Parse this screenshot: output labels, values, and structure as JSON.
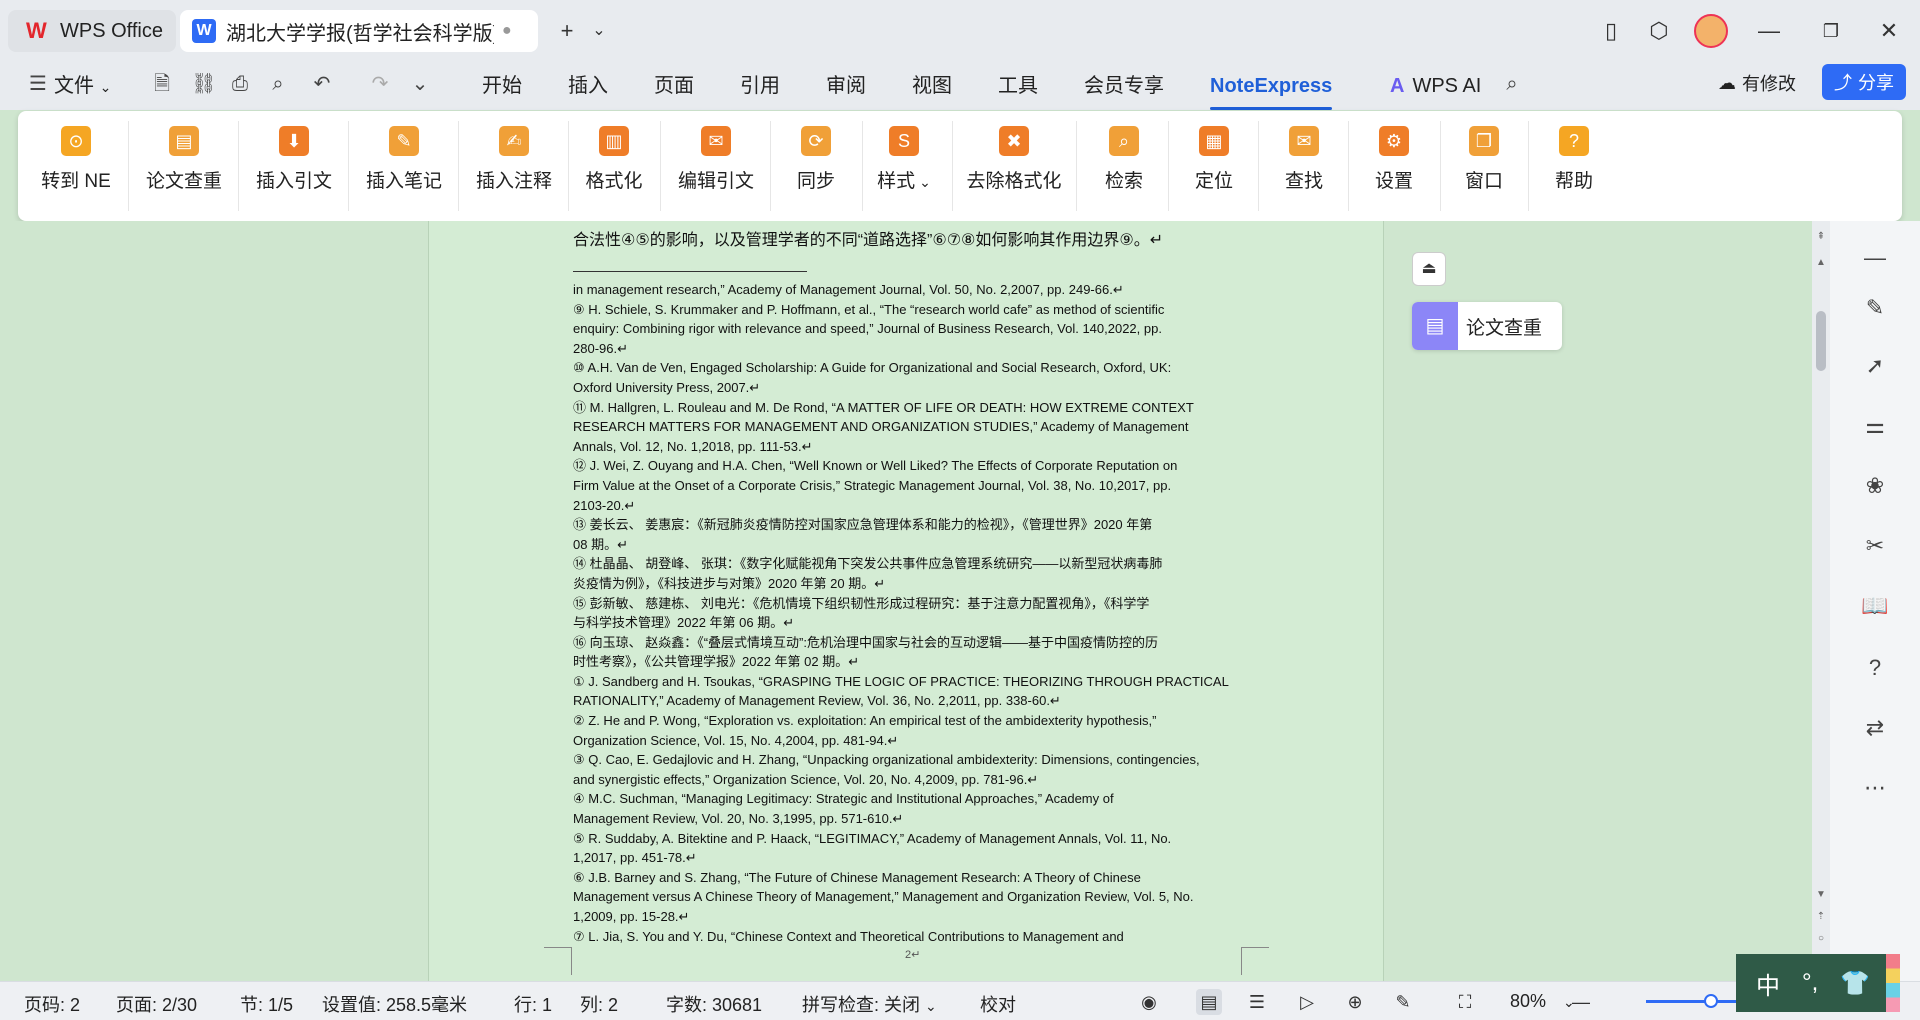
{
  "tabs": [
    {
      "label": "WPS Office"
    },
    {
      "label": "湖北大学学报(哲学社会科学版) 投稿",
      "modified": "●"
    }
  ],
  "titlebar": {
    "new_tab": "+",
    "dropdown": "⌄"
  },
  "menu": {
    "file": "文件",
    "items": [
      "开始",
      "插入",
      "页面",
      "引用",
      "审阅",
      "视图",
      "工具",
      "会员专享",
      "NoteExpress",
      "WPS AI"
    ],
    "active": "NoteExpress",
    "modify": "有修改",
    "share": "分享"
  },
  "ribbon": [
    {
      "label": "转到 NE",
      "color": "#f5a623",
      "icon": "ne-icon"
    },
    {
      "label": "论文查重",
      "color": "#f0a038",
      "icon": "clipboard-icon"
    },
    {
      "label": "插入引文",
      "color": "#ef7d28",
      "icon": "insert-citation-icon"
    },
    {
      "label": "插入笔记",
      "color": "#f0a038",
      "icon": "pencil-icon"
    },
    {
      "label": "插入注释",
      "color": "#f0a038",
      "icon": "annotation-icon"
    },
    {
      "label": "格式化",
      "color": "#ef7d28",
      "icon": "format-icon"
    },
    {
      "label": "编辑引文",
      "color": "#ef7d28",
      "icon": "edit-citation-icon"
    },
    {
      "label": "同步",
      "color": "#f0a038",
      "icon": "sync-icon"
    },
    {
      "label": "样式",
      "color": "#ef7d28",
      "icon": "style-icon"
    },
    {
      "label": "去除格式化",
      "color": "#ef7d28",
      "icon": "remove-format-icon"
    },
    {
      "label": "检索",
      "color": "#f0a038",
      "icon": "search-icon"
    },
    {
      "label": "定位",
      "color": "#ef7d28",
      "icon": "locate-icon"
    },
    {
      "label": "查找",
      "color": "#f0a038",
      "icon": "find-icon"
    },
    {
      "label": "设置",
      "color": "#ef7d28",
      "icon": "gear-icon"
    },
    {
      "label": "窗口",
      "color": "#f0a038",
      "icon": "window-icon"
    },
    {
      "label": "帮助",
      "color": "#f5a623",
      "icon": "help-icon"
    }
  ],
  "document": {
    "head_line": "合法性④⑤的影响，以及管理学者的不同“道路选择”⑥⑦⑧如何影响其作用边界⑨。↵",
    "ref_lines": [
      "in management research,” Academy of Management Journal, Vol. 50, No. 2,2007, pp. 249-66.↵",
      "⑨ H. Schiele, S. Krummaker and P. Hoffmann, et al., “The “research world cafe” as method of scientific",
      "enquiry: Combining rigor with relevance and speed,” Journal of Business Research, Vol. 140,2022, pp.",
      "280-96.↵",
      "⑩ A.H. Van de Ven, Engaged Scholarship: A Guide for Organizational and Social Research, Oxford, UK:",
      "Oxford University Press, 2007.↵",
      "⑪ M. Hallgren, L. Rouleau and M. De Rond, “A MATTER OF LIFE OR DEATH: HOW EXTREME CONTEXT",
      "RESEARCH MATTERS FOR MANAGEMENT AND ORGANIZATION STUDIES,” Academy of Management",
      "Annals, Vol. 12, No. 1,2018, pp. 111-53.↵",
      "⑫ J. Wei, Z. Ouyang and H.A. Chen, “Well Known or Well Liked? The Effects of Corporate Reputation on",
      "Firm Value at the Onset of a Corporate Crisis,” Strategic Management Journal, Vol. 38, No. 10,2017, pp.",
      "2103-20.↵",
      "⑬ 姜长云、 姜惠宸：《新冠肺炎疫情防控对国家应急管理体系和能力的检视》，《管理世界》2020 年第",
      "08 期。↵",
      "⑭ 杜晶晶、 胡登峰、 张琪：《数字化赋能视角下突发公共事件应急管理系统研究——以新型冠状病毒肺",
      "炎疫情为例》，《科技进步与对策》2020 年第 20 期。↵",
      "⑮ 彭新敏、 慈建栋、 刘电光：《危机情境下组织韧性形成过程研究：基于注意力配置视角》，《科学学",
      "与科学技术管理》2022 年第 06 期。↵",
      "⑯ 向玉琼、 赵焱鑫：《“叠层式情境互动”:危机治理中国家与社会的互动逻辑——基于中国疫情防控的历",
      "时性考察》，《公共管理学报》2022 年第 02 期。↵",
      "① J. Sandberg and H. Tsoukas, “GRASPING THE LOGIC OF PRACTICE: THEORIZING THROUGH PRACTICAL",
      "RATIONALITY,” Academy of Management Review, Vol. 36, No. 2,2011, pp. 338-60.↵",
      "② Z. He and P. Wong, “Exploration vs. exploitation: An empirical test of the ambidexterity hypothesis,”",
      "Organization Science, Vol. 15, No. 4,2004, pp. 481-94.↵",
      "③ Q. Cao, E. Gedajlovic and H. Zhang, “Unpacking organizational ambidexterity: Dimensions, contingencies,",
      "and synergistic effects,” Organization Science, Vol. 20, No. 4,2009, pp. 781-96.↵",
      "④ M.C. Suchman, “Managing Legitimacy: Strategic and Institutional Approaches,” Academy of",
      "Management Review, Vol. 20, No. 3,1995, pp. 571-610.↵",
      "⑤ R. Suddaby, A. Bitektine and P. Haack, “LEGITIMACY,” Academy of Management Annals, Vol. 11, No.",
      "1,2017, pp. 451-78.↵",
      "⑥ J.B. Barney and S. Zhang, “The Future of Chinese Management Research: A Theory of Chinese",
      "Management versus A Chinese Theory of Management,” Management and Organization Review, Vol. 5, No.",
      "1,2009, pp. 15-28.↵",
      "⑦ L. Jia, S. You and Y. Du, “Chinese Context and Theoretical Contributions to Management and"
    ],
    "page_number": "2↵"
  },
  "floating": {
    "check_label": "论文查重"
  },
  "status": {
    "page_code": "页码: 2",
    "page": "页面: 2/30",
    "section": "节: 1/5",
    "setting": "设置值: 258.5毫米",
    "row": "行: 1",
    "col": "列: 2",
    "words": "字数: 30681",
    "spell": "拼写检查: 关闭",
    "proof": "校对",
    "zoom": "80%"
  },
  "ime": {
    "lang": "中",
    "punct": "°,"
  }
}
